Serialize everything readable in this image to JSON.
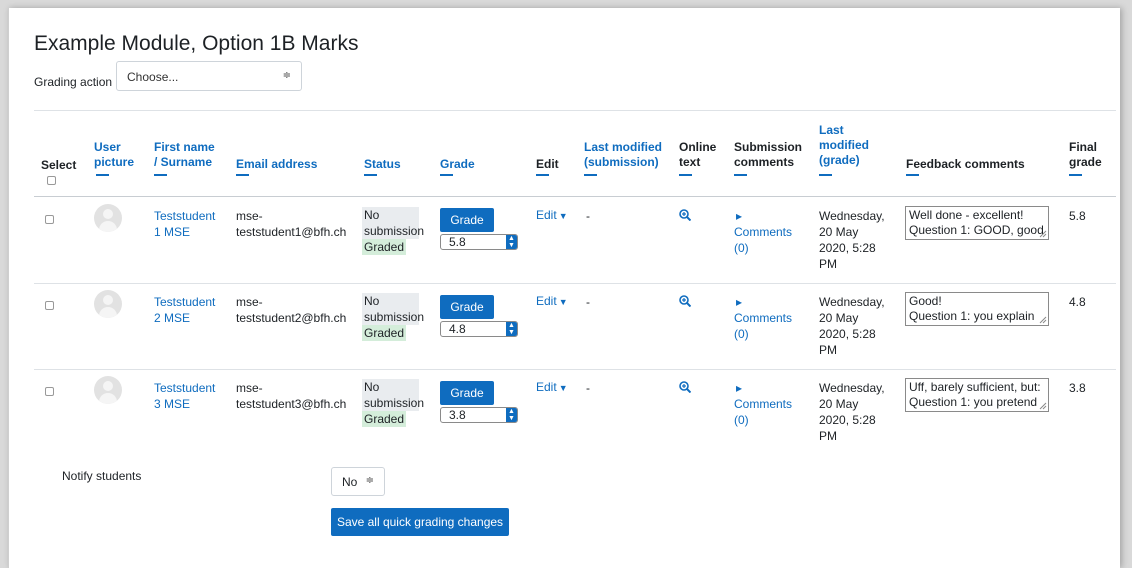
{
  "page_title": "Example Module, Option 1B Marks",
  "grading_action": {
    "label": "Grading action",
    "selected": "Choose...",
    "caret": "≑"
  },
  "columns": {
    "select": "Select",
    "user_picture": [
      "User",
      "picture"
    ],
    "name": [
      "First name",
      "/ Surname"
    ],
    "email": "Email address",
    "status": "Status",
    "grade": "Grade",
    "edit": "Edit",
    "last_modified_submission": [
      "Last modified",
      "(submission)"
    ],
    "online_text": [
      "Online",
      "text"
    ],
    "submission_comments": [
      "Submission",
      "comments"
    ],
    "last_modified_grade": [
      "Last",
      "modified",
      "(grade)"
    ],
    "feedback_comments": "Feedback comments",
    "final_grade": [
      "Final",
      "grade"
    ]
  },
  "rows": [
    {
      "name": [
        "Teststudent",
        "1 MSE"
      ],
      "email": [
        "mse-",
        "teststudent1@bfh.ch"
      ],
      "status": [
        "No",
        "submission"
      ],
      "graded": "Graded",
      "grade_button": "Grade",
      "grade_value": "5.8",
      "edit": "Edit",
      "last_modified_submission": "-",
      "comments": [
        "Comments",
        "(0)"
      ],
      "last_modified_grade": [
        "Wednesday,",
        "20 May",
        "2020, 5:28",
        "PM"
      ],
      "feedback": [
        "Well done - excellent!",
        "Question 1: GOOD, good"
      ],
      "final_grade": "5.8"
    },
    {
      "name": [
        "Teststudent",
        "2 MSE"
      ],
      "email": [
        "mse-",
        "teststudent2@bfh.ch"
      ],
      "status": [
        "No",
        "submission"
      ],
      "graded": "Graded",
      "grade_button": "Grade",
      "grade_value": "4.8",
      "edit": "Edit",
      "last_modified_submission": "-",
      "comments": [
        "Comments",
        "(0)"
      ],
      "last_modified_grade": [
        "Wednesday,",
        "20 May",
        "2020, 5:28",
        "PM"
      ],
      "feedback": [
        "Good!",
        "Question 1: you explain"
      ],
      "final_grade": "4.8"
    },
    {
      "name": [
        "Teststudent",
        "3 MSE"
      ],
      "email": [
        "mse-",
        "teststudent3@bfh.ch"
      ],
      "status": [
        "No",
        "submission"
      ],
      "graded": "Graded",
      "grade_button": "Grade",
      "grade_value": "3.8",
      "edit": "Edit",
      "last_modified_submission": "-",
      "comments": [
        "Comments",
        "(0)"
      ],
      "last_modified_grade": [
        "Wednesday,",
        "20 May",
        "2020, 5:28",
        "PM"
      ],
      "feedback": [
        "Uff, barely sufficient, but:",
        "Question 1: you pretend"
      ],
      "final_grade": "3.8"
    }
  ],
  "notify": {
    "label": "Notify students",
    "selected": "No",
    "caret": "≑"
  },
  "save_button": "Save all quick grading changes",
  "colors": {
    "accent": "#0f6cbf",
    "graded_bg": "#d4edda",
    "status_bg": "#e9ecef"
  },
  "icons": [
    "magnifier-plus-icon",
    "caret-right-icon",
    "caret-down-icon",
    "avatar-placeholder-icon"
  ]
}
